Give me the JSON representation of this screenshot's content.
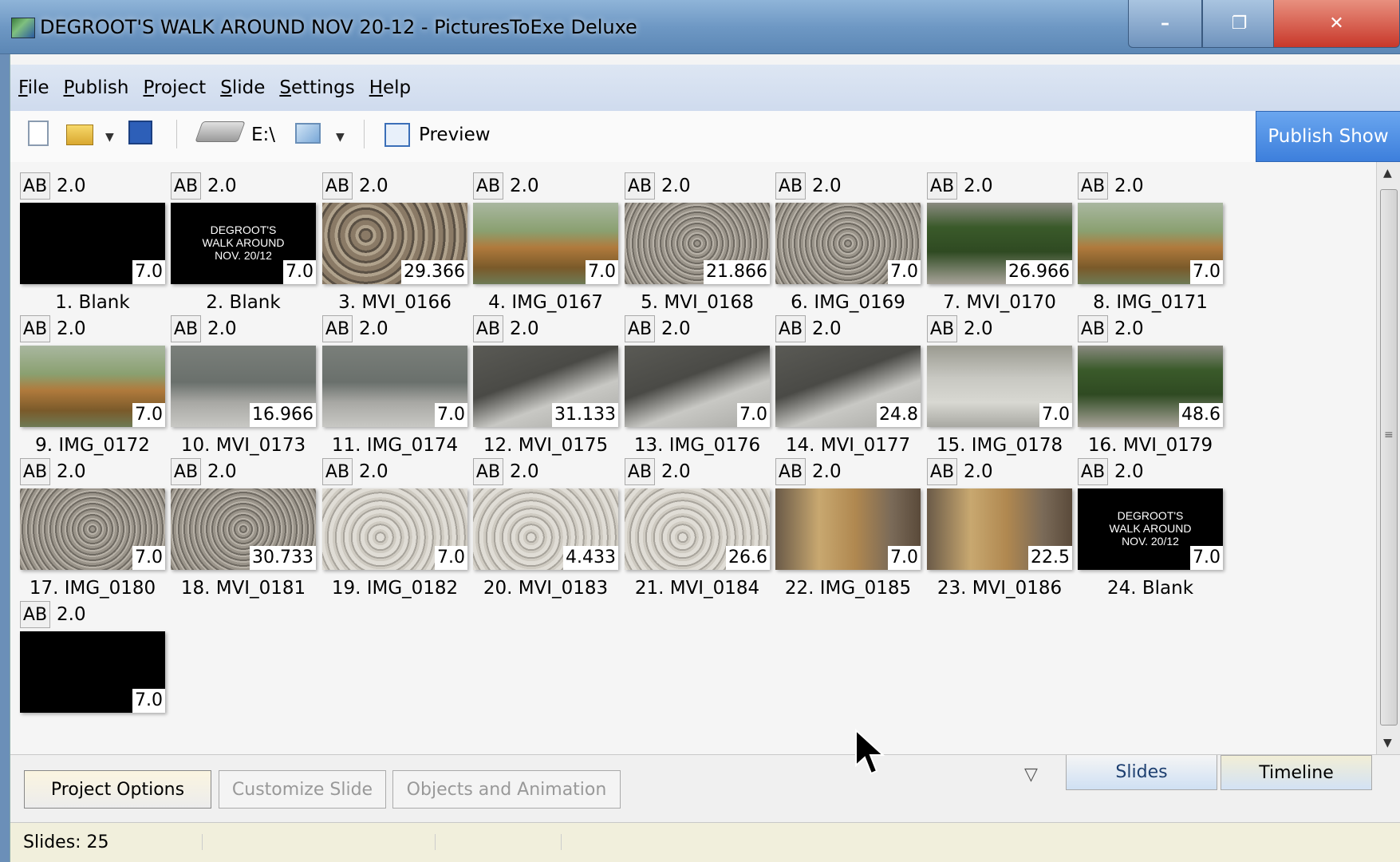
{
  "window": {
    "title": "DEGROOT'S WALK AROUND NOV 20-12 - PicturesToExe Deluxe",
    "minimize": "–",
    "maximize": "❐",
    "close": "✕"
  },
  "menu": [
    "File",
    "Publish",
    "Project",
    "Slide",
    "Settings",
    "Help"
  ],
  "toolbar": {
    "drive_label": "E:\\",
    "preview_label": "Preview",
    "publish_label": "Publish Show"
  },
  "slides": [
    {
      "ab": "AB",
      "trans": "2.0",
      "dur": "7.0",
      "name": "1. Blank",
      "kind": "black",
      "text": ""
    },
    {
      "ab": "AB",
      "trans": "2.0",
      "dur": "7.0",
      "name": "2. Blank",
      "kind": "black",
      "text": "DEGROOT'S\nWALK AROUND\nNOV. 20/12"
    },
    {
      "ab": "AB",
      "trans": "2.0",
      "dur": "29.366",
      "name": "3. MVI_0166",
      "kind": "rocks",
      "text": ""
    },
    {
      "ab": "AB",
      "trans": "2.0",
      "dur": "7.0",
      "name": "4. IMG_0167",
      "kind": "grass",
      "text": ""
    },
    {
      "ab": "AB",
      "trans": "2.0",
      "dur": "21.866",
      "name": "5. MVI_0168",
      "kind": "gravel",
      "text": ""
    },
    {
      "ab": "AB",
      "trans": "2.0",
      "dur": "7.0",
      "name": "6. IMG_0169",
      "kind": "gravel",
      "text": ""
    },
    {
      "ab": "AB",
      "trans": "2.0",
      "dur": "26.966",
      "name": "7. MVI_0170",
      "kind": "shrubs",
      "text": ""
    },
    {
      "ab": "AB",
      "trans": "2.0",
      "dur": "7.0",
      "name": "8. IMG_0171",
      "kind": "grass",
      "text": ""
    },
    {
      "ab": "AB",
      "trans": "2.0",
      "dur": "7.0",
      "name": "9. IMG_0172",
      "kind": "grass",
      "text": ""
    },
    {
      "ab": "AB",
      "trans": "2.0",
      "dur": "16.966",
      "name": "10. MVI_0173",
      "kind": "heather",
      "text": ""
    },
    {
      "ab": "AB",
      "trans": "2.0",
      "dur": "7.0",
      "name": "11. IMG_0174",
      "kind": "heather",
      "text": ""
    },
    {
      "ab": "AB",
      "trans": "2.0",
      "dur": "31.133",
      "name": "12. MVI_0175",
      "kind": "path",
      "text": ""
    },
    {
      "ab": "AB",
      "trans": "2.0",
      "dur": "7.0",
      "name": "13. IMG_0176",
      "kind": "path",
      "text": ""
    },
    {
      "ab": "AB",
      "trans": "2.0",
      "dur": "24.8",
      "name": "14. MVI_0177",
      "kind": "path",
      "text": ""
    },
    {
      "ab": "AB",
      "trans": "2.0",
      "dur": "7.0",
      "name": "15. IMG_0178",
      "kind": "curb",
      "text": ""
    },
    {
      "ab": "AB",
      "trans": "2.0",
      "dur": "48.6",
      "name": "16. MVI_0179",
      "kind": "shrubs",
      "text": ""
    },
    {
      "ab": "AB",
      "trans": "2.0",
      "dur": "7.0",
      "name": "17. IMG_0180",
      "kind": "gravel",
      "text": ""
    },
    {
      "ab": "AB",
      "trans": "2.0",
      "dur": "30.733",
      "name": "18. MVI_0181",
      "kind": "gravel",
      "text": ""
    },
    {
      "ab": "AB",
      "trans": "2.0",
      "dur": "7.0",
      "name": "19. IMG_0182",
      "kind": "pebbles",
      "text": ""
    },
    {
      "ab": "AB",
      "trans": "2.0",
      "dur": "4.433",
      "name": "20. MVI_0183",
      "kind": "pebbles",
      "text": ""
    },
    {
      "ab": "AB",
      "trans": "2.0",
      "dur": "26.6",
      "name": "21. MVI_0184",
      "kind": "pebbles",
      "text": ""
    },
    {
      "ab": "AB",
      "trans": "2.0",
      "dur": "7.0",
      "name": "22. IMG_0185",
      "kind": "building",
      "text": ""
    },
    {
      "ab": "AB",
      "trans": "2.0",
      "dur": "22.5",
      "name": "23. MVI_0186",
      "kind": "building",
      "text": ""
    },
    {
      "ab": "AB",
      "trans": "2.0",
      "dur": "7.0",
      "name": "24. Blank",
      "kind": "black",
      "text": "DEGROOT'S\nWALK AROUND\nNOV. 20/12"
    },
    {
      "ab": "AB",
      "trans": "2.0",
      "dur": "7.0",
      "name": "",
      "kind": "black",
      "text": ""
    }
  ],
  "bottom": {
    "project_options": "Project Options",
    "customize_slide": "Customize Slide",
    "objects_animation": "Objects and Animation",
    "tab_slides": "Slides",
    "tab_timeline": "Timeline"
  },
  "status": {
    "slides_count": "Slides: 25"
  },
  "colors": {
    "publish_button": "#4a8ae6",
    "close_button": "#c8382a"
  }
}
